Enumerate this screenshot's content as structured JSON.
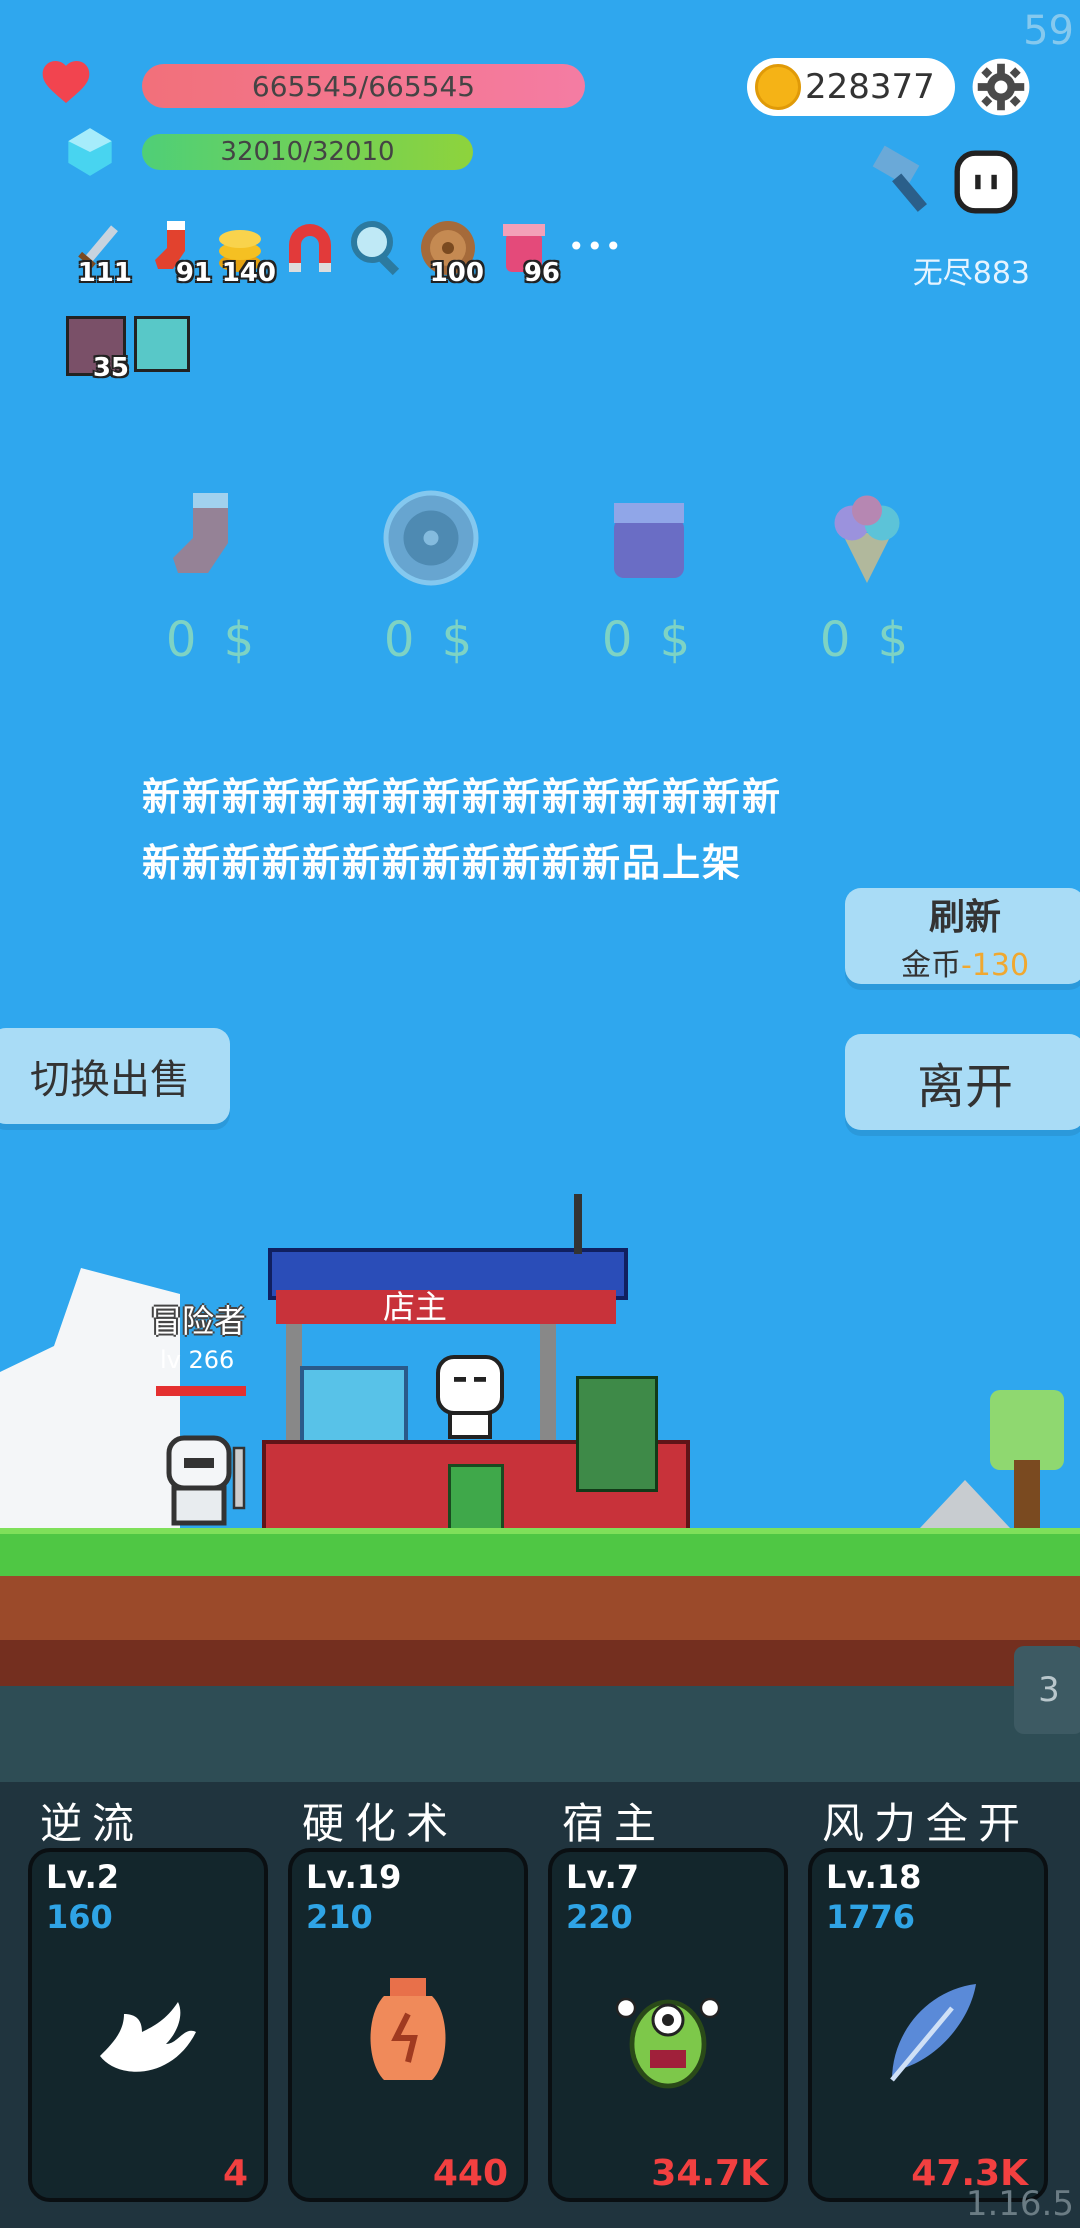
{
  "fps": "59",
  "stats": {
    "hp": "665545/665545",
    "mp": "32010/32010"
  },
  "gold": "228377",
  "mode": "无尽883",
  "buffs": [
    {
      "name": "sword",
      "count": "111"
    },
    {
      "name": "sock",
      "count": "91"
    },
    {
      "name": "coins",
      "count": "140"
    },
    {
      "name": "magnet",
      "count": ""
    },
    {
      "name": "magnifier",
      "count": ""
    },
    {
      "name": "shield",
      "count": "100"
    },
    {
      "name": "jam",
      "count": "96"
    }
  ],
  "more": "•••",
  "buffs2": [
    {
      "name": "sword-box",
      "count": "35"
    },
    {
      "name": "lightbulb",
      "count": ""
    }
  ],
  "shop": [
    {
      "icon": "sock-icon",
      "price": "0 $"
    },
    {
      "icon": "shield-icon",
      "price": "0 $"
    },
    {
      "icon": "jam-icon",
      "price": "0 $"
    },
    {
      "icon": "ice-cream-icon",
      "price": "0 $"
    }
  ],
  "message": {
    "line1": "新新新新新新新新新新新新新新新新",
    "line2": "新新新新新新新新新新新新品上架"
  },
  "refresh": {
    "title": "刷新",
    "cost_label": "金币",
    "cost_value": "-130"
  },
  "leave": "离开",
  "swap": "切换出售",
  "scene": {
    "shopkeeper": "店主",
    "adventurer": "冒险者",
    "adventurer_lv": "lv 266"
  },
  "skills": [
    {
      "name": "逆流",
      "lv": "Lv.2",
      "cost": "160",
      "num": "4",
      "icon": "wing-icon"
    },
    {
      "name": "硬化术",
      "lv": "Lv.19",
      "cost": "210",
      "num": "440",
      "icon": "vase-icon"
    },
    {
      "name": "宿主",
      "lv": "Lv.7",
      "cost": "220",
      "num": "34.7K",
      "icon": "monster-icon"
    },
    {
      "name": "风力全开",
      "lv": "Lv.18",
      "cost": "1776",
      "num": "47.3K",
      "icon": "feather-icon"
    }
  ],
  "tab_badge": "3",
  "version": "1.16.5",
  "colors": {
    "sky": "#2fa7ee",
    "hp": "#f2707a",
    "mp": "#4fcf77",
    "accent": "#f0a830"
  }
}
